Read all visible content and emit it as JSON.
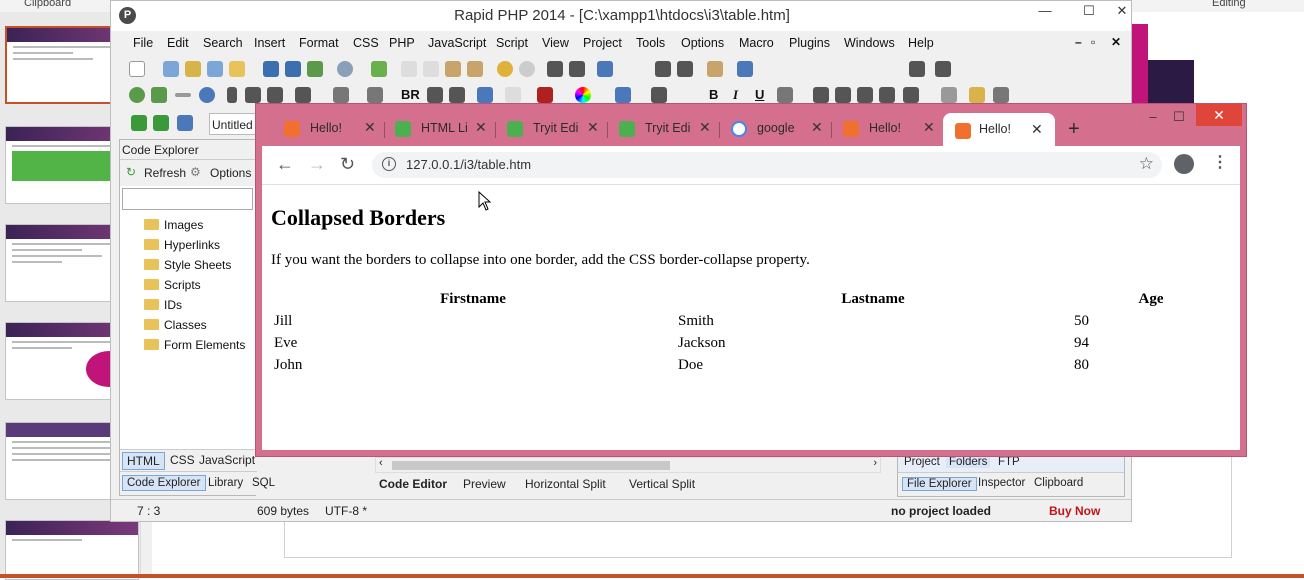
{
  "background": {
    "top_left_label": "Clipboard",
    "top_right_label": "Editing",
    "accent_color": "#c5502a"
  },
  "rapid_php": {
    "title": "Rapid PHP 2014 - [C:\\xampp1\\htdocs\\i3\\table.htm]",
    "menu": [
      "File",
      "Edit",
      "Search",
      "Insert",
      "Format",
      "CSS",
      "PHP",
      "JavaScript",
      "Script",
      "View",
      "Project",
      "Tools",
      "Options",
      "Macro",
      "Plugins",
      "Windows",
      "Help"
    ],
    "toolbar_text": {
      "br": "BR",
      "bold": "B",
      "italic": "I",
      "underline": "U"
    },
    "untitled_tab": "Untitled",
    "code_explorer": {
      "header": "Code Explorer",
      "refresh": "Refresh",
      "options": "Options",
      "tree": [
        "Images",
        "Hyperlinks",
        "Style Sheets",
        "Scripts",
        "IDs",
        "Classes",
        "Form Elements"
      ],
      "lang_tabs": [
        "HTML",
        "CSS",
        "JavaScript"
      ],
      "bottom_tabs": [
        "Code Explorer",
        "Library",
        "SQL"
      ]
    },
    "editor_tabs": [
      "Code Editor",
      "Preview",
      "Horizontal Split",
      "Vertical Split"
    ],
    "right_panel": {
      "top_tabs": [
        "Project",
        "Folders",
        "FTP"
      ],
      "bottom_tabs": [
        "File Explorer",
        "Inspector",
        "Clipboard"
      ]
    },
    "status": {
      "position": "7 : 3",
      "size": "609 bytes",
      "encoding": "UTF-8 *",
      "project": "no project loaded",
      "buy": "Buy Now"
    }
  },
  "chrome": {
    "tabs": [
      {
        "label": "Hello!",
        "icon": "xampp-icon"
      },
      {
        "label": "HTML Li",
        "icon": "w3-icon"
      },
      {
        "label": "Tryit Edi",
        "icon": "w3-icon"
      },
      {
        "label": "Tryit Edi",
        "icon": "w3-icon"
      },
      {
        "label": "google",
        "icon": "google-icon"
      },
      {
        "label": "Hello!",
        "icon": "xampp-icon"
      },
      {
        "label": "Hello!",
        "icon": "xampp-icon"
      }
    ],
    "url": "127.0.0.1/i3/table.htm",
    "page": {
      "heading": "Collapsed Borders",
      "paragraph": "If you want the borders to collapse into one border, add the CSS border-collapse property.",
      "table": {
        "headers": [
          "Firstname",
          "Lastname",
          "Age"
        ],
        "rows": [
          [
            "Jill",
            "Smith",
            "50"
          ],
          [
            "Eve",
            "Jackson",
            "94"
          ],
          [
            "John",
            "Doe",
            "80"
          ]
        ]
      }
    },
    "frame_color": "#d4708d"
  }
}
